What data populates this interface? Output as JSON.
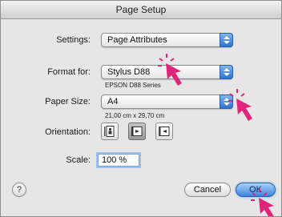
{
  "window": {
    "title": "Page Setup"
  },
  "settings": {
    "label": "Settings:",
    "value": "Page Attributes"
  },
  "format_for": {
    "label": "Format for:",
    "value": "Stylus D88",
    "note": "EPSON D88 Series"
  },
  "paper_size": {
    "label": "Paper Size:",
    "value": "A4",
    "note": "21,00 cm x 29,70 cm"
  },
  "orientation": {
    "label": "Orientation:",
    "selected": "landscape-left",
    "options": [
      "portrait",
      "landscape-left",
      "landscape-right"
    ]
  },
  "scale": {
    "label": "Scale:",
    "value": "100 %"
  },
  "buttons": {
    "help": "?",
    "cancel": "Cancel",
    "ok": "OK"
  },
  "colors": {
    "accent": "#3c86de",
    "pointer": "#e0267a"
  }
}
